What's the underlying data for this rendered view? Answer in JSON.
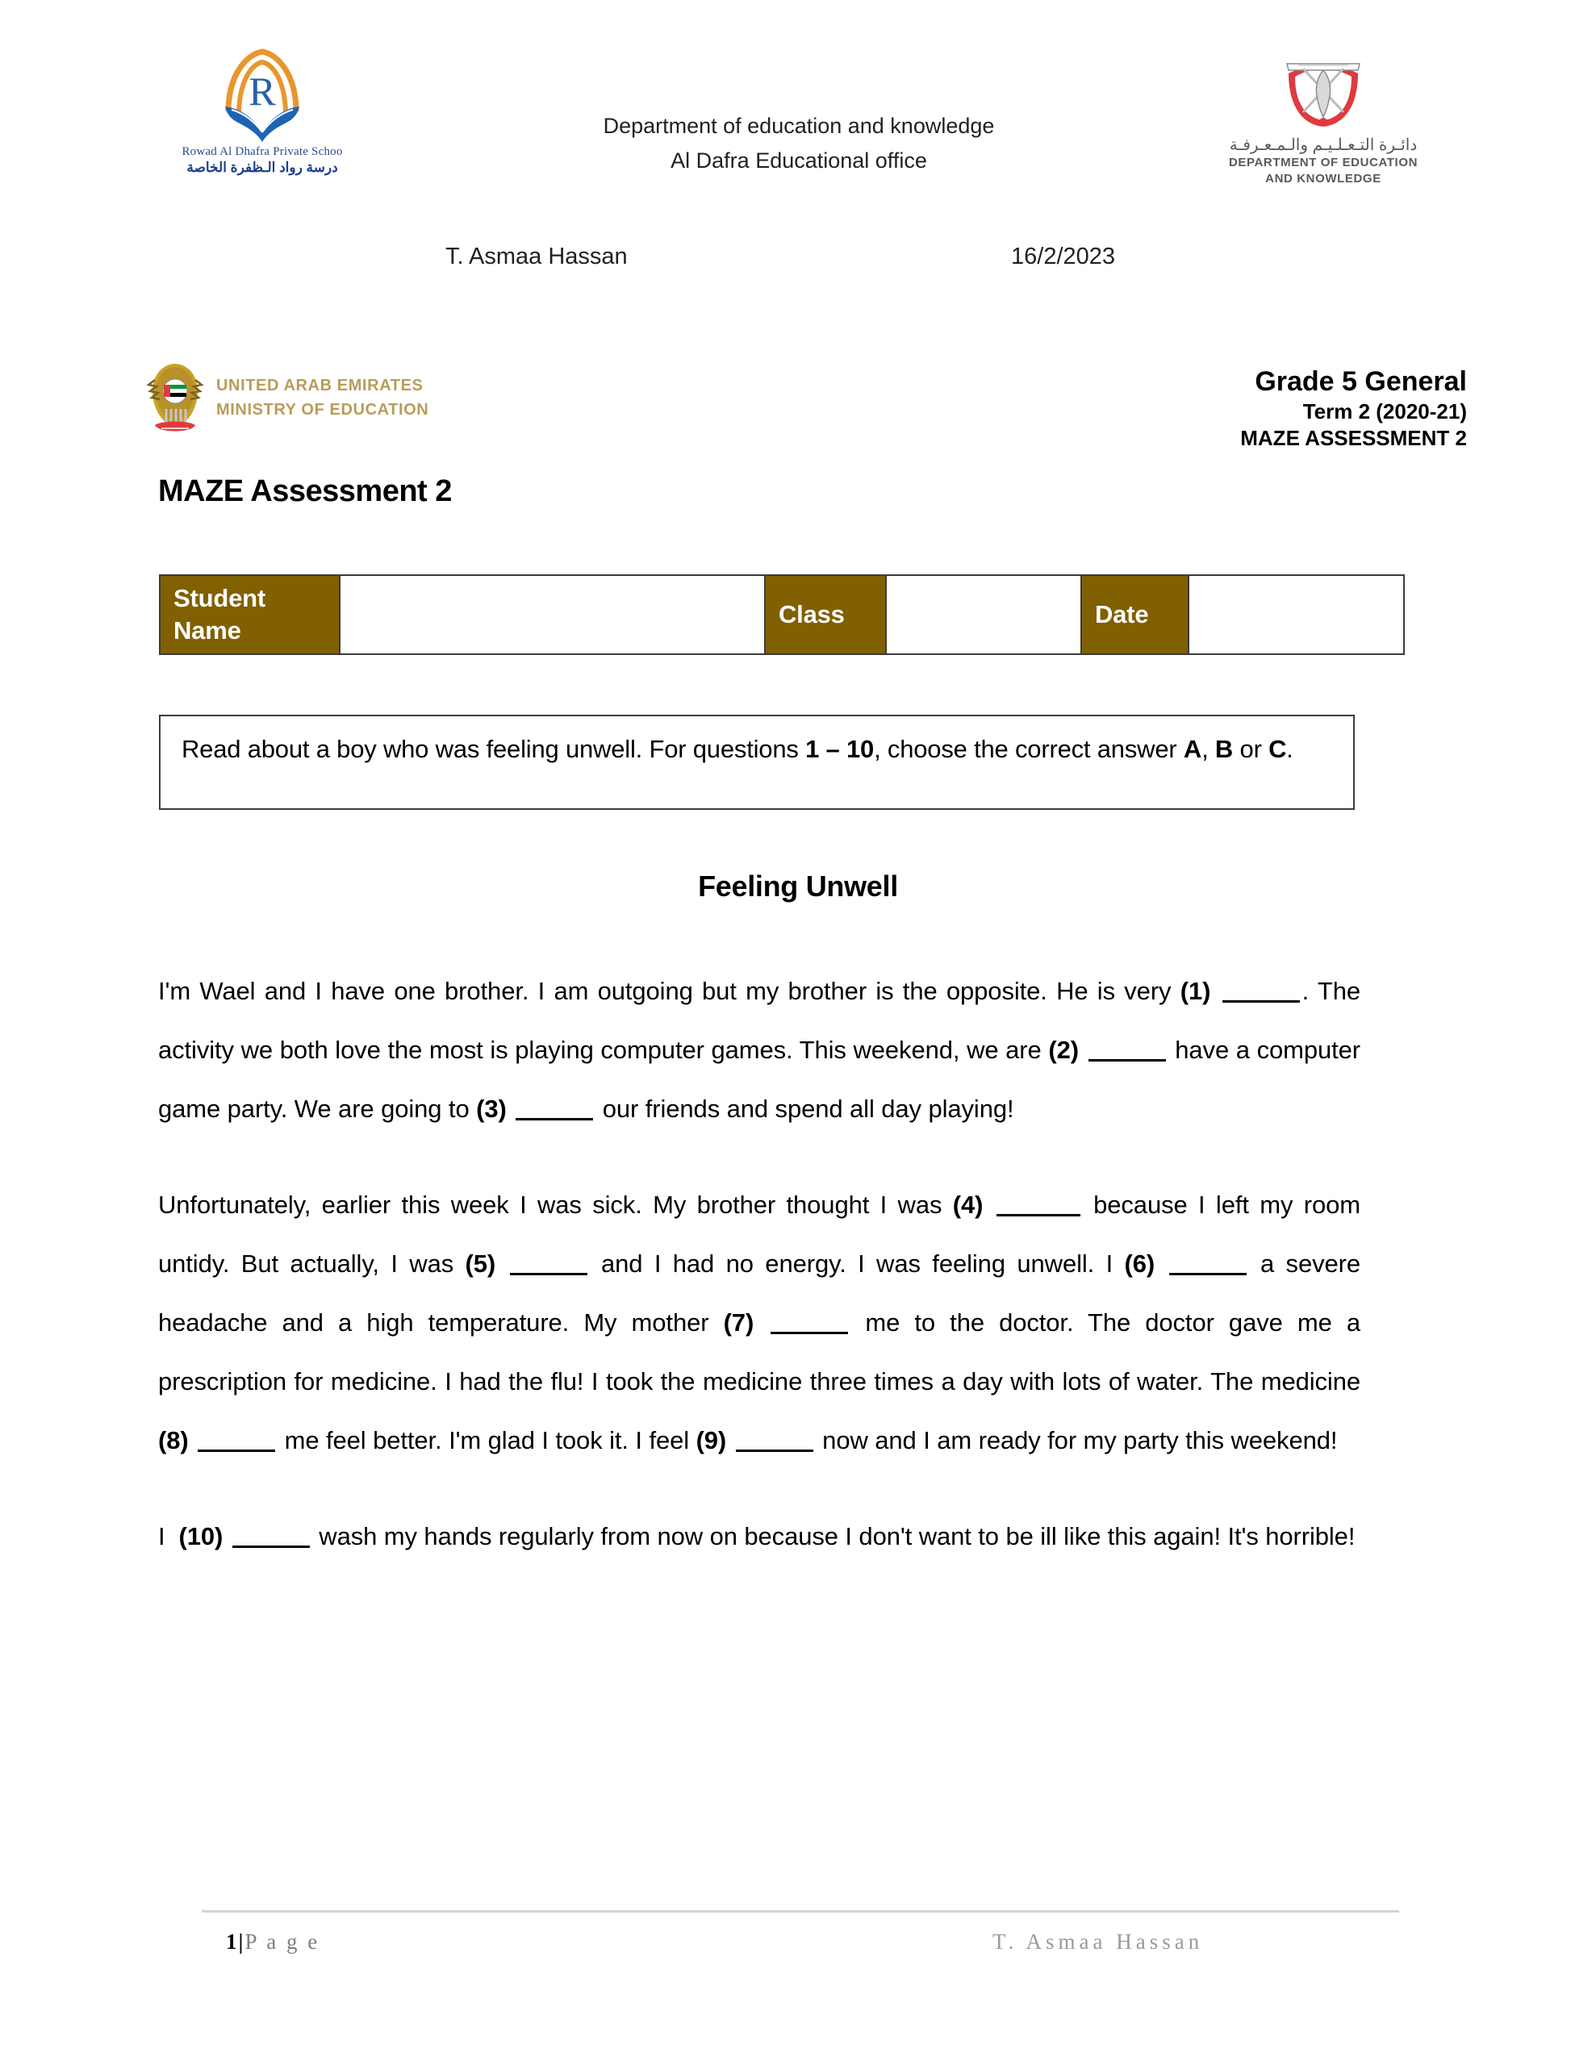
{
  "header": {
    "school_logo": {
      "letter": "R",
      "name_en": "Rowad Al Dhafra Private Schoo",
      "name_ar": "درسة رواد الـظفرة الخاصة"
    },
    "department_line1": "Department of education and knowledge",
    "department_line2": "Al Dafra Educational office",
    "doek_logo": {
      "arabic": "دائـرة التـعـلـيـم والـمـعـرفـة",
      "english_line1": "DEPARTMENT OF EDUCATION",
      "english_line2": "AND KNOWLEDGE"
    }
  },
  "meta": {
    "teacher": "T. Asmaa Hassan",
    "date": "16/2/2023"
  },
  "moe": {
    "line1": "UNITED ARAB EMIRATES",
    "line2": "MINISTRY OF EDUCATION",
    "text_color": "#b99c5a"
  },
  "grade_block": {
    "line1": "Grade 5 General",
    "line2": "Term 2 (2020-21)",
    "line3": "MAZE ASSESSMENT 2"
  },
  "doc_title": "MAZE Assessment 2",
  "info_table": {
    "header_bg": "#806000",
    "student_name_label": "Student Name",
    "student_name_value": "",
    "class_label": "Class",
    "class_value": "",
    "date_label": "Date",
    "date_value": ""
  },
  "instructions": {
    "part1": "Read about a boy who was feeling unwell. For questions ",
    "range": "1 – 10",
    "part2": ", choose the correct answer ",
    "opt_a": "A",
    "sep1": ", ",
    "opt_b": "B",
    "sep2": " or ",
    "opt_c": "C",
    "end": "."
  },
  "reading_title": "Feeling Unwell",
  "passage": {
    "p1": {
      "s1": "I'm Wael and I have one brother.  I am outgoing but my brother is the opposite. He is very ",
      "q1": "(1)",
      "s2": ". The activity we both love the most is playing computer games. This weekend, we are ",
      "q2": "(2)",
      "s3": " have a computer game party. We are going to ",
      "q3": "(3)",
      "s4": " our friends and spend all day playing!"
    },
    "p2": {
      "s1": "Unfortunately, earlier this week I was sick. My brother thought I was ",
      "q4": "(4)",
      "s2": " because I left my room untidy. But actually, I was ",
      "q5": "(5)",
      "s3": " and I had no energy. I was feeling unwell. I ",
      "q6": "(6)",
      "s4": " a severe headache and a high temperature. My mother ",
      "q7": "(7)",
      "s5": " me to the doctor. The doctor gave me a prescription for medicine. I had the flu! I took the medicine three times a day with lots of water. The medicine ",
      "q8": "(8)",
      "s6": " me feel  better. I'm glad I took it. I feel ",
      "q9": "(9)",
      "s7": " now and I am ready for my party this weekend!"
    },
    "p3": {
      "s1": "I ",
      "q10": "(10)",
      "s2": " wash my hands regularly from now on because I don't want to be ill like this again! It's horrible!"
    }
  },
  "footer": {
    "page_number": "1",
    "separator": "|",
    "page_word": "P a g e",
    "right_text": "T. Asmaa Hassan"
  }
}
